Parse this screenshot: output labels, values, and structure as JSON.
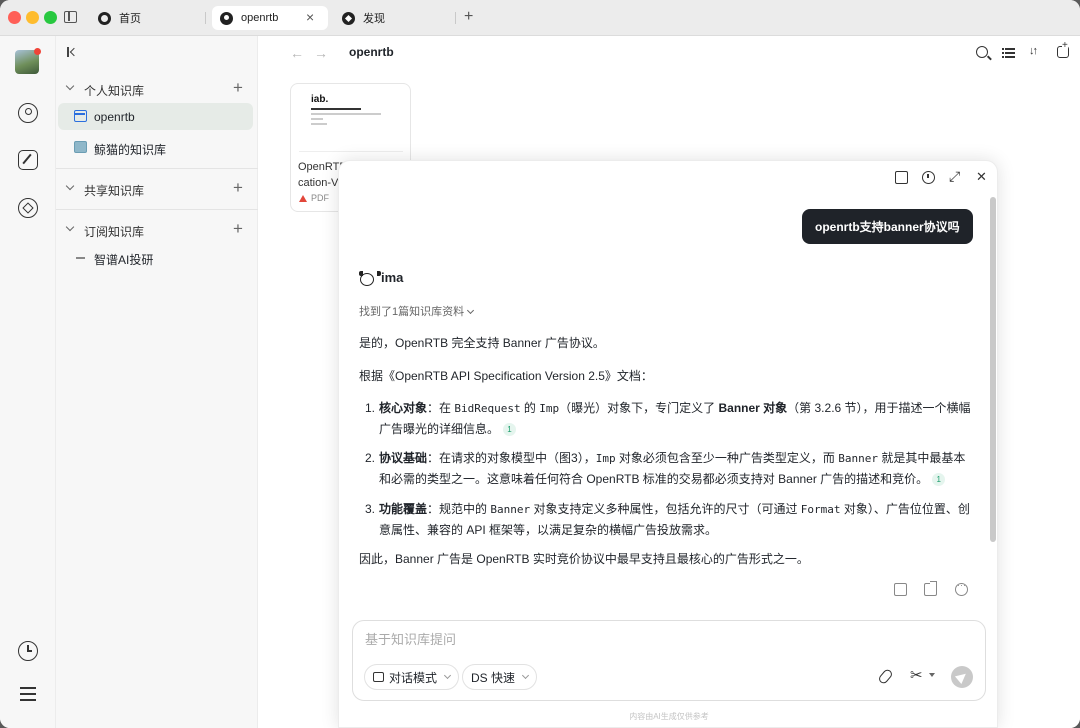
{
  "tabs": [
    {
      "label": "首页",
      "icon": "globe-icon"
    },
    {
      "label": "openrtb",
      "icon": "bulb-icon"
    },
    {
      "label": "发现",
      "icon": "compass-icon"
    }
  ],
  "sidebar": {
    "sections": [
      {
        "label": "个人知识库",
        "items": [
          {
            "label": "openrtb",
            "icon": "notebook-icon",
            "active": true
          },
          {
            "label": "鲸猫的知识库",
            "icon": "image-icon",
            "active": false
          }
        ]
      },
      {
        "label": "共享知识库",
        "items": []
      },
      {
        "label": "订阅知识库",
        "items": [
          {
            "label": "智谱AI投研",
            "icon": "dash-icon",
            "active": false
          }
        ]
      }
    ]
  },
  "main": {
    "title": "openrtb",
    "doc": {
      "logo": "iab.",
      "name": "OpenRTB cation-V",
      "type": "PDF"
    }
  },
  "chat": {
    "user_message": "openrtb支持banner协议吗",
    "bot_name": "ima",
    "found_text": "找到了1篇知识库资料",
    "intro": "是的，OpenRTB 完全支持 Banner 广告协议。",
    "source_line": "根据《OpenRTB API Specification Version 2.5》文档：",
    "points": [
      {
        "num": "1.",
        "title": "核心对象",
        "p1": "：在 ",
        "code1": "BidRequest",
        "p2": " 的 ",
        "code2": "Imp",
        "p3": "（曝光）对象下，专门定义了 ",
        "bold": "Banner 对象",
        "p4": "（第 3.2.6 节），用于描述一个横幅广告曝光的详细信息。",
        "cite": "1"
      },
      {
        "num": "2.",
        "title": "协议基础",
        "p1": "：在请求的对象模型中（图3），",
        "code1": "Imp",
        "p2": " 对象必须包含至少一种广告类型定义，而 ",
        "code2": "Banner",
        "p3": " 就是其中最基本和必需的类型之一。这意味着任何符合 OpenRTB 标准的交易都必须支持对 Banner 广告的描述和竞价。",
        "cite": "1"
      },
      {
        "num": "3.",
        "title": "功能覆盖",
        "p1": "：规范中的 ",
        "code1": "Banner",
        "p2": " 对象支持定义多种属性，包括允许的尺寸（可通过 ",
        "code2": "Format",
        "p3": " 对象）、广告位位置、创意属性、兼容的 API 框架等，以满足复杂的横幅广告投放需求。"
      }
    ],
    "conclusion": "因此，Banner 广告是 OpenRTB 实时竞价协议中最早支持且最核心的广告形式之一。",
    "input_placeholder": "基于知识库提问",
    "mode_label": "对话模式",
    "model_label": "DS 快速",
    "disclaimer": "内容由AI生成仅供参考"
  }
}
